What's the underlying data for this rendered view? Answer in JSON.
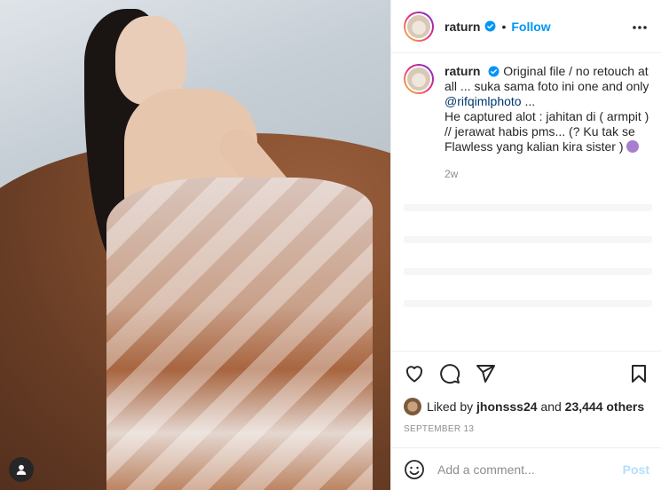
{
  "post": {
    "image_alt": "",
    "user_tag_icon": "user-tag-icon"
  },
  "header": {
    "username": "raturn",
    "verified_icon": "verified-badge-icon",
    "separator": "•",
    "follow_label": "Follow",
    "more_icon": "more-options-icon"
  },
  "caption": {
    "username": "raturn",
    "text_1": "Original file / no retouch at all ... suka sama foto ini one and only",
    "mention": "@rifqimlphoto",
    "text_2": "...",
    "text_3": "He captured alot : jahitan di ( armpit ) // jerawat habis pms... (? Ku tak se Flawless yang kalian kira sister )",
    "time_ago": "2w"
  },
  "actions": {
    "like_icon": "heart-icon",
    "comment_icon": "comment-icon",
    "share_icon": "share-icon",
    "save_icon": "bookmark-icon"
  },
  "likes": {
    "prefix": "Liked by",
    "user": "jhonsss24",
    "middle": "and",
    "count": "23,444 others"
  },
  "date": "SEPTEMBER 13",
  "comment_box": {
    "placeholder": "Add a comment...",
    "post_label": "Post"
  },
  "colors": {
    "accent_blue": "#0095f6",
    "post_disabled": "#b2dffc",
    "muted": "#8e8e8e"
  }
}
